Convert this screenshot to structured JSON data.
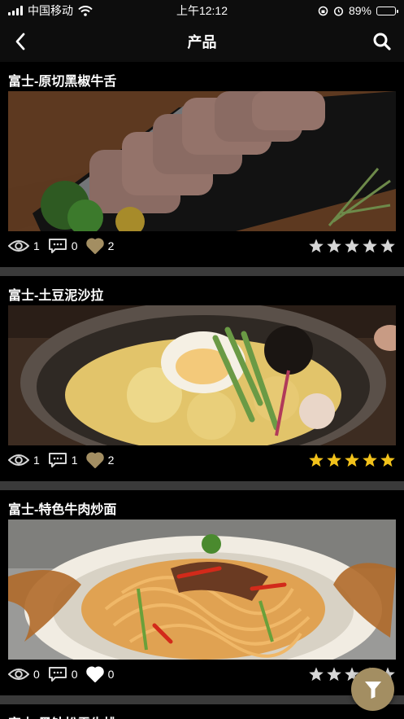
{
  "status_bar": {
    "carrier": "中国移动",
    "time": "上午12:12",
    "battery": "89%",
    "battery_level": 0.89
  },
  "nav": {
    "title": "产品",
    "back_icon": "chevron-left-icon",
    "search_icon": "search-icon"
  },
  "colors": {
    "background": "#000000",
    "divider": "#3a3a3a",
    "accent_gold": "#a38e62",
    "star_gold": "#f2c21b",
    "star_gray": "#d6d6d6"
  },
  "products": [
    {
      "title": "富士-原切黑椒牛舌",
      "views": "1",
      "comments": "0",
      "likes": "2",
      "liked": true,
      "rating": 0
    },
    {
      "title": "富士-土豆泥沙拉",
      "views": "1",
      "comments": "1",
      "likes": "2",
      "liked": true,
      "rating": 5
    },
    {
      "title": "富士-特色牛肉炒面",
      "views": "0",
      "comments": "0",
      "likes": "0",
      "liked": false,
      "rating": 0
    },
    {
      "title": "富士-黑钻松露牛排"
    }
  ],
  "filter_fab": {
    "icon": "filter-icon"
  }
}
